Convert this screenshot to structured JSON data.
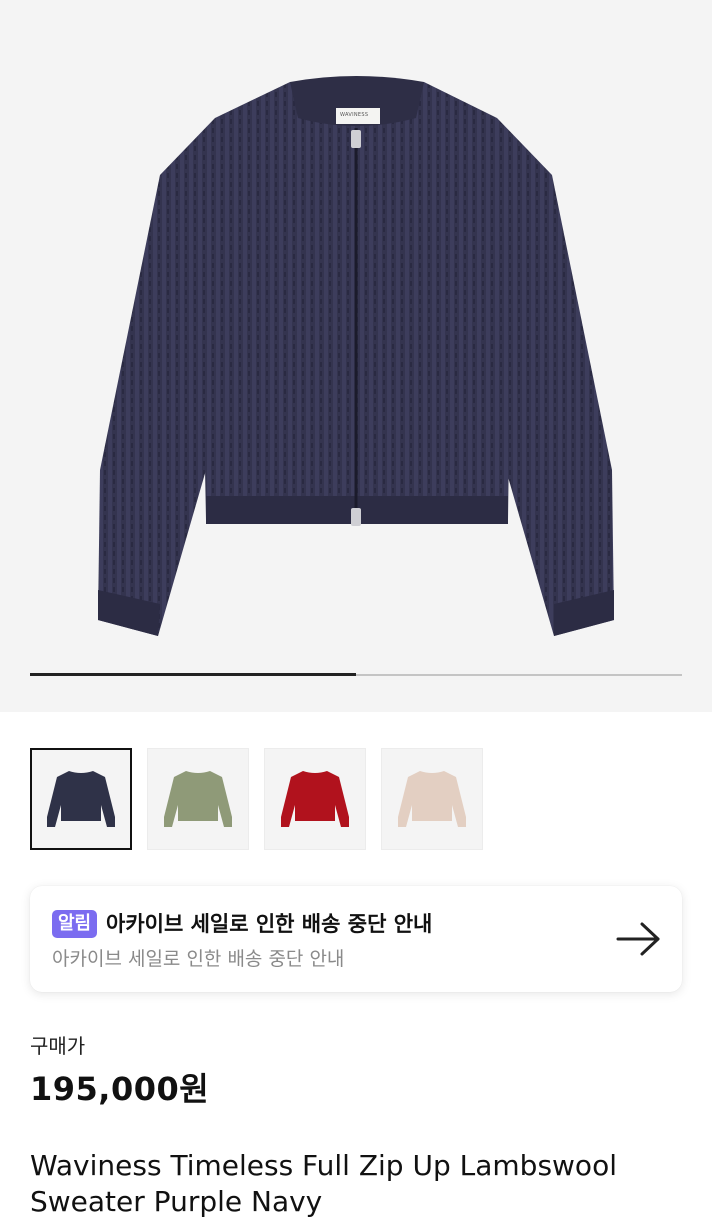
{
  "gallery": {
    "progress": 0.5,
    "label_text": "WAVINESS",
    "main_color": "#34344f",
    "thumbnails": [
      {
        "color_name": "navy",
        "color": "#2f3248",
        "selected": true
      },
      {
        "color_name": "olive",
        "color": "#8f9a78",
        "selected": false
      },
      {
        "color_name": "red",
        "color": "#b1121d",
        "selected": false
      },
      {
        "color_name": "beige",
        "color": "#e3cfc2",
        "selected": false
      }
    ]
  },
  "notice": {
    "badge": "알림",
    "title": "아카이브 세일로 인한 배송 중단 안내",
    "subtitle": "아카이브 세일로 인한 배송 중단 안내",
    "badge_color": "#7b6cf0",
    "icon": "arrow-right-icon"
  },
  "price": {
    "label": "구매가",
    "value": "195,000원"
  },
  "product": {
    "name": "Waviness Timeless Full Zip Up Lambswool Sweater Purple Navy"
  }
}
